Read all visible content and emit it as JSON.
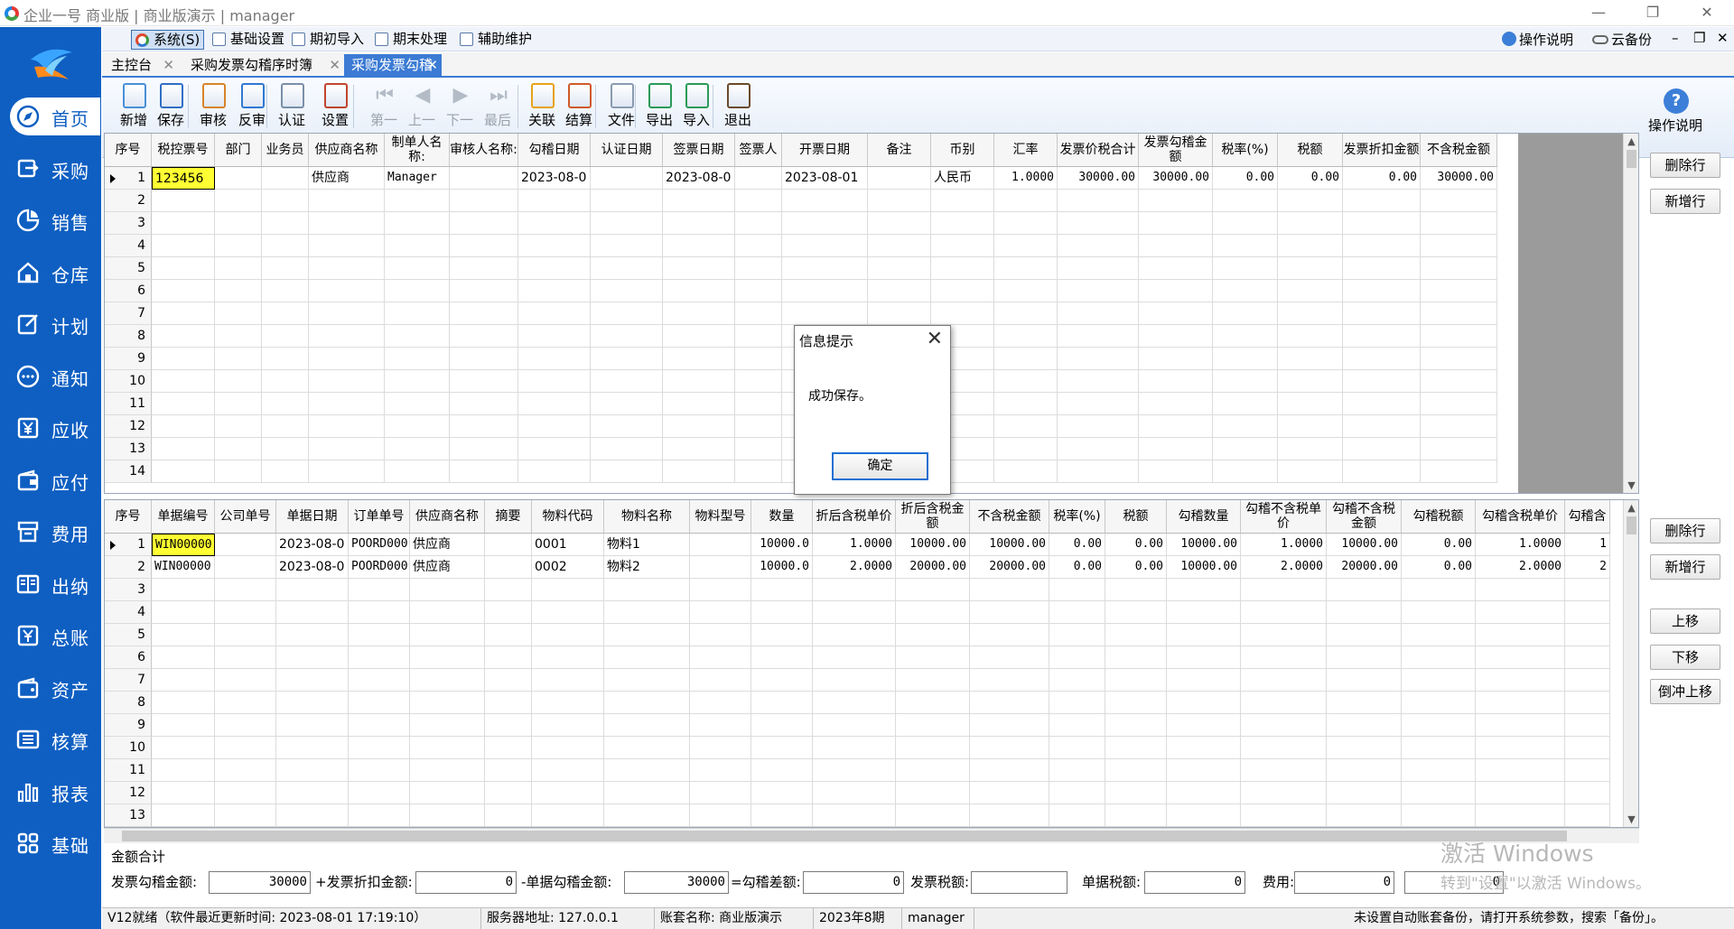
{
  "window": {
    "title": "企业一号 商业版 | 商业版演示 | manager",
    "minimize": "—",
    "maximize": "❐",
    "close": "✕"
  },
  "sidebar": {
    "items": [
      {
        "label": "首页",
        "icon": "compass-icon",
        "active": true
      },
      {
        "label": "采购",
        "icon": "purchase-icon"
      },
      {
        "label": "销售",
        "icon": "pie-chart-icon"
      },
      {
        "label": "仓库",
        "icon": "home-icon"
      },
      {
        "label": "计划",
        "icon": "edit-icon"
      },
      {
        "label": "通知",
        "icon": "chat-icon"
      },
      {
        "label": "应收",
        "icon": "yuan-icon"
      },
      {
        "label": "应付",
        "icon": "wallet-icon"
      },
      {
        "label": "费用",
        "icon": "register-icon"
      },
      {
        "label": "出纳",
        "icon": "book-icon"
      },
      {
        "label": "总账",
        "icon": "ledger-icon"
      },
      {
        "label": "资产",
        "icon": "asset-icon"
      },
      {
        "label": "核算",
        "icon": "calc-icon"
      },
      {
        "label": "报表",
        "icon": "bar-chart-icon"
      },
      {
        "label": "基础",
        "icon": "grid-icon"
      }
    ]
  },
  "menubar": {
    "items": [
      "系统(S)",
      "基础设置",
      "期初导入",
      "期末处理",
      "辅助维护"
    ],
    "help": "操作说明",
    "backup": "云备份",
    "min": "–",
    "restore": "❐",
    "close": "✕"
  },
  "tabs": [
    {
      "label": "主控台"
    },
    {
      "label": "采购发票勾稽序时簿"
    },
    {
      "label": "采购发票勾稽",
      "active": true
    }
  ],
  "tab_close": "✕",
  "toolbar": {
    "buttons": [
      {
        "label": "新增"
      },
      {
        "label": "保存"
      },
      {
        "label": "审核"
      },
      {
        "label": "反审"
      },
      {
        "label": "认证"
      },
      {
        "label": "设置"
      },
      {
        "label": "第一"
      },
      {
        "label": "上一"
      },
      {
        "label": "下一"
      },
      {
        "label": "最后"
      },
      {
        "label": "关联"
      },
      {
        "label": "结算"
      },
      {
        "label": "文件"
      },
      {
        "label": "导出"
      },
      {
        "label": "导入"
      },
      {
        "label": "退出"
      }
    ],
    "help": "操作说明"
  },
  "top_grid": {
    "headers": [
      "序号",
      "税控票号",
      "部门",
      "业务员",
      "供应商名称",
      "制单人名称:",
      "审核人名称:",
      "勾稽日期",
      "认证日期",
      "签票日期",
      "签票人",
      "开票日期",
      "备注",
      "币别",
      "汇率",
      "发票价税合计",
      "发票勾稽金额",
      "税率(%)",
      "税额",
      "发票折扣金额",
      "不含税金额"
    ],
    "rows": [
      [
        "1",
        "123456",
        "",
        "",
        "供应商",
        "Manager",
        "",
        "2023-08-0",
        "",
        "2023-08-0",
        "",
        "2023-08-01",
        "",
        "人民币",
        "1.0000",
        "30000.00",
        "30000.00",
        "0.00",
        "0.00",
        "0.00",
        "30000.00"
      ]
    ],
    "empty_rows": [
      "2",
      "3",
      "4",
      "5",
      "6",
      "7",
      "8",
      "9",
      "10",
      "11",
      "12",
      "13",
      "14"
    ]
  },
  "bottom_grid": {
    "headers": [
      "序号",
      "单据编号",
      "公司单号",
      "单据日期",
      "订单单号",
      "供应商名称",
      "摘要",
      "物料代码",
      "物料名称",
      "物料型号",
      "数量",
      "折后含税单价",
      "折后含税金额",
      "不含税金额",
      "税率(%)",
      "税额",
      "勾稽数量",
      "勾稽不含税单价",
      "勾稽不含税金额",
      "勾稽税额",
      "勾稽含税单价",
      "勾稽含"
    ],
    "rows": [
      [
        "1",
        "WIN00000",
        "",
        "2023-08-0",
        "POORD000",
        "供应商",
        "",
        "0001",
        "物料1",
        "",
        "10000.0",
        "1.0000",
        "10000.00",
        "10000.00",
        "0.00",
        "0.00",
        "10000.00",
        "1.0000",
        "10000.00",
        "0.00",
        "1.0000",
        "1"
      ],
      [
        "2",
        "WIN00000",
        "",
        "2023-08-0",
        "POORD000",
        "供应商",
        "",
        "0002",
        "物料2",
        "",
        "10000.0",
        "2.0000",
        "20000.00",
        "20000.00",
        "0.00",
        "0.00",
        "10000.00",
        "2.0000",
        "20000.00",
        "0.00",
        "2.0000",
        "2"
      ]
    ],
    "empty_rows": [
      "3",
      "4",
      "5",
      "6",
      "7",
      "8",
      "9",
      "10",
      "11",
      "12",
      "13"
    ]
  },
  "side_buttons_top": [
    "删除行",
    "新增行"
  ],
  "side_buttons_bottom": [
    "删除行",
    "新增行",
    "上移",
    "下移",
    "倒冲上移"
  ],
  "scroll_up": "▲",
  "scroll_down": "▼",
  "totals": {
    "title": "金额合计",
    "fields": [
      {
        "label": "发票勾稽金额:",
        "value": "30000"
      },
      {
        "label": "+发票折扣金额:",
        "value": "0"
      },
      {
        "label": "-单据勾稽金额:",
        "value": "30000"
      },
      {
        "label": "=勾稽差额:",
        "value": "0"
      },
      {
        "label": "发票税额:",
        "value": ""
      },
      {
        "label": "单据税额:",
        "value": "0"
      },
      {
        "label": "费用:",
        "value": "0"
      },
      {
        "label": "",
        "value": "0"
      }
    ]
  },
  "watermark": {
    "line1": "激活 Windows",
    "line2": "转到\"设置\"以激活 Windows。"
  },
  "statusbar": {
    "ready": "V12就绪（软件最近更新时间: 2023-08-01 17:19:10）",
    "server": "服务器地址: 127.0.0.1",
    "account": "账套名称: 商业版演示",
    "period": "2023年8期",
    "user": "manager",
    "notice": "未设置自动账套备份，请打开系统参数，搜索「备份」。"
  },
  "dialog": {
    "title": "信息提示",
    "close": "✕",
    "message": "成功保存。",
    "ok": "确定"
  },
  "colors": {
    "sidebar": "#0f5fc2",
    "tab_active": "#3b7bd4",
    "selected_cell": "#ffff33"
  }
}
